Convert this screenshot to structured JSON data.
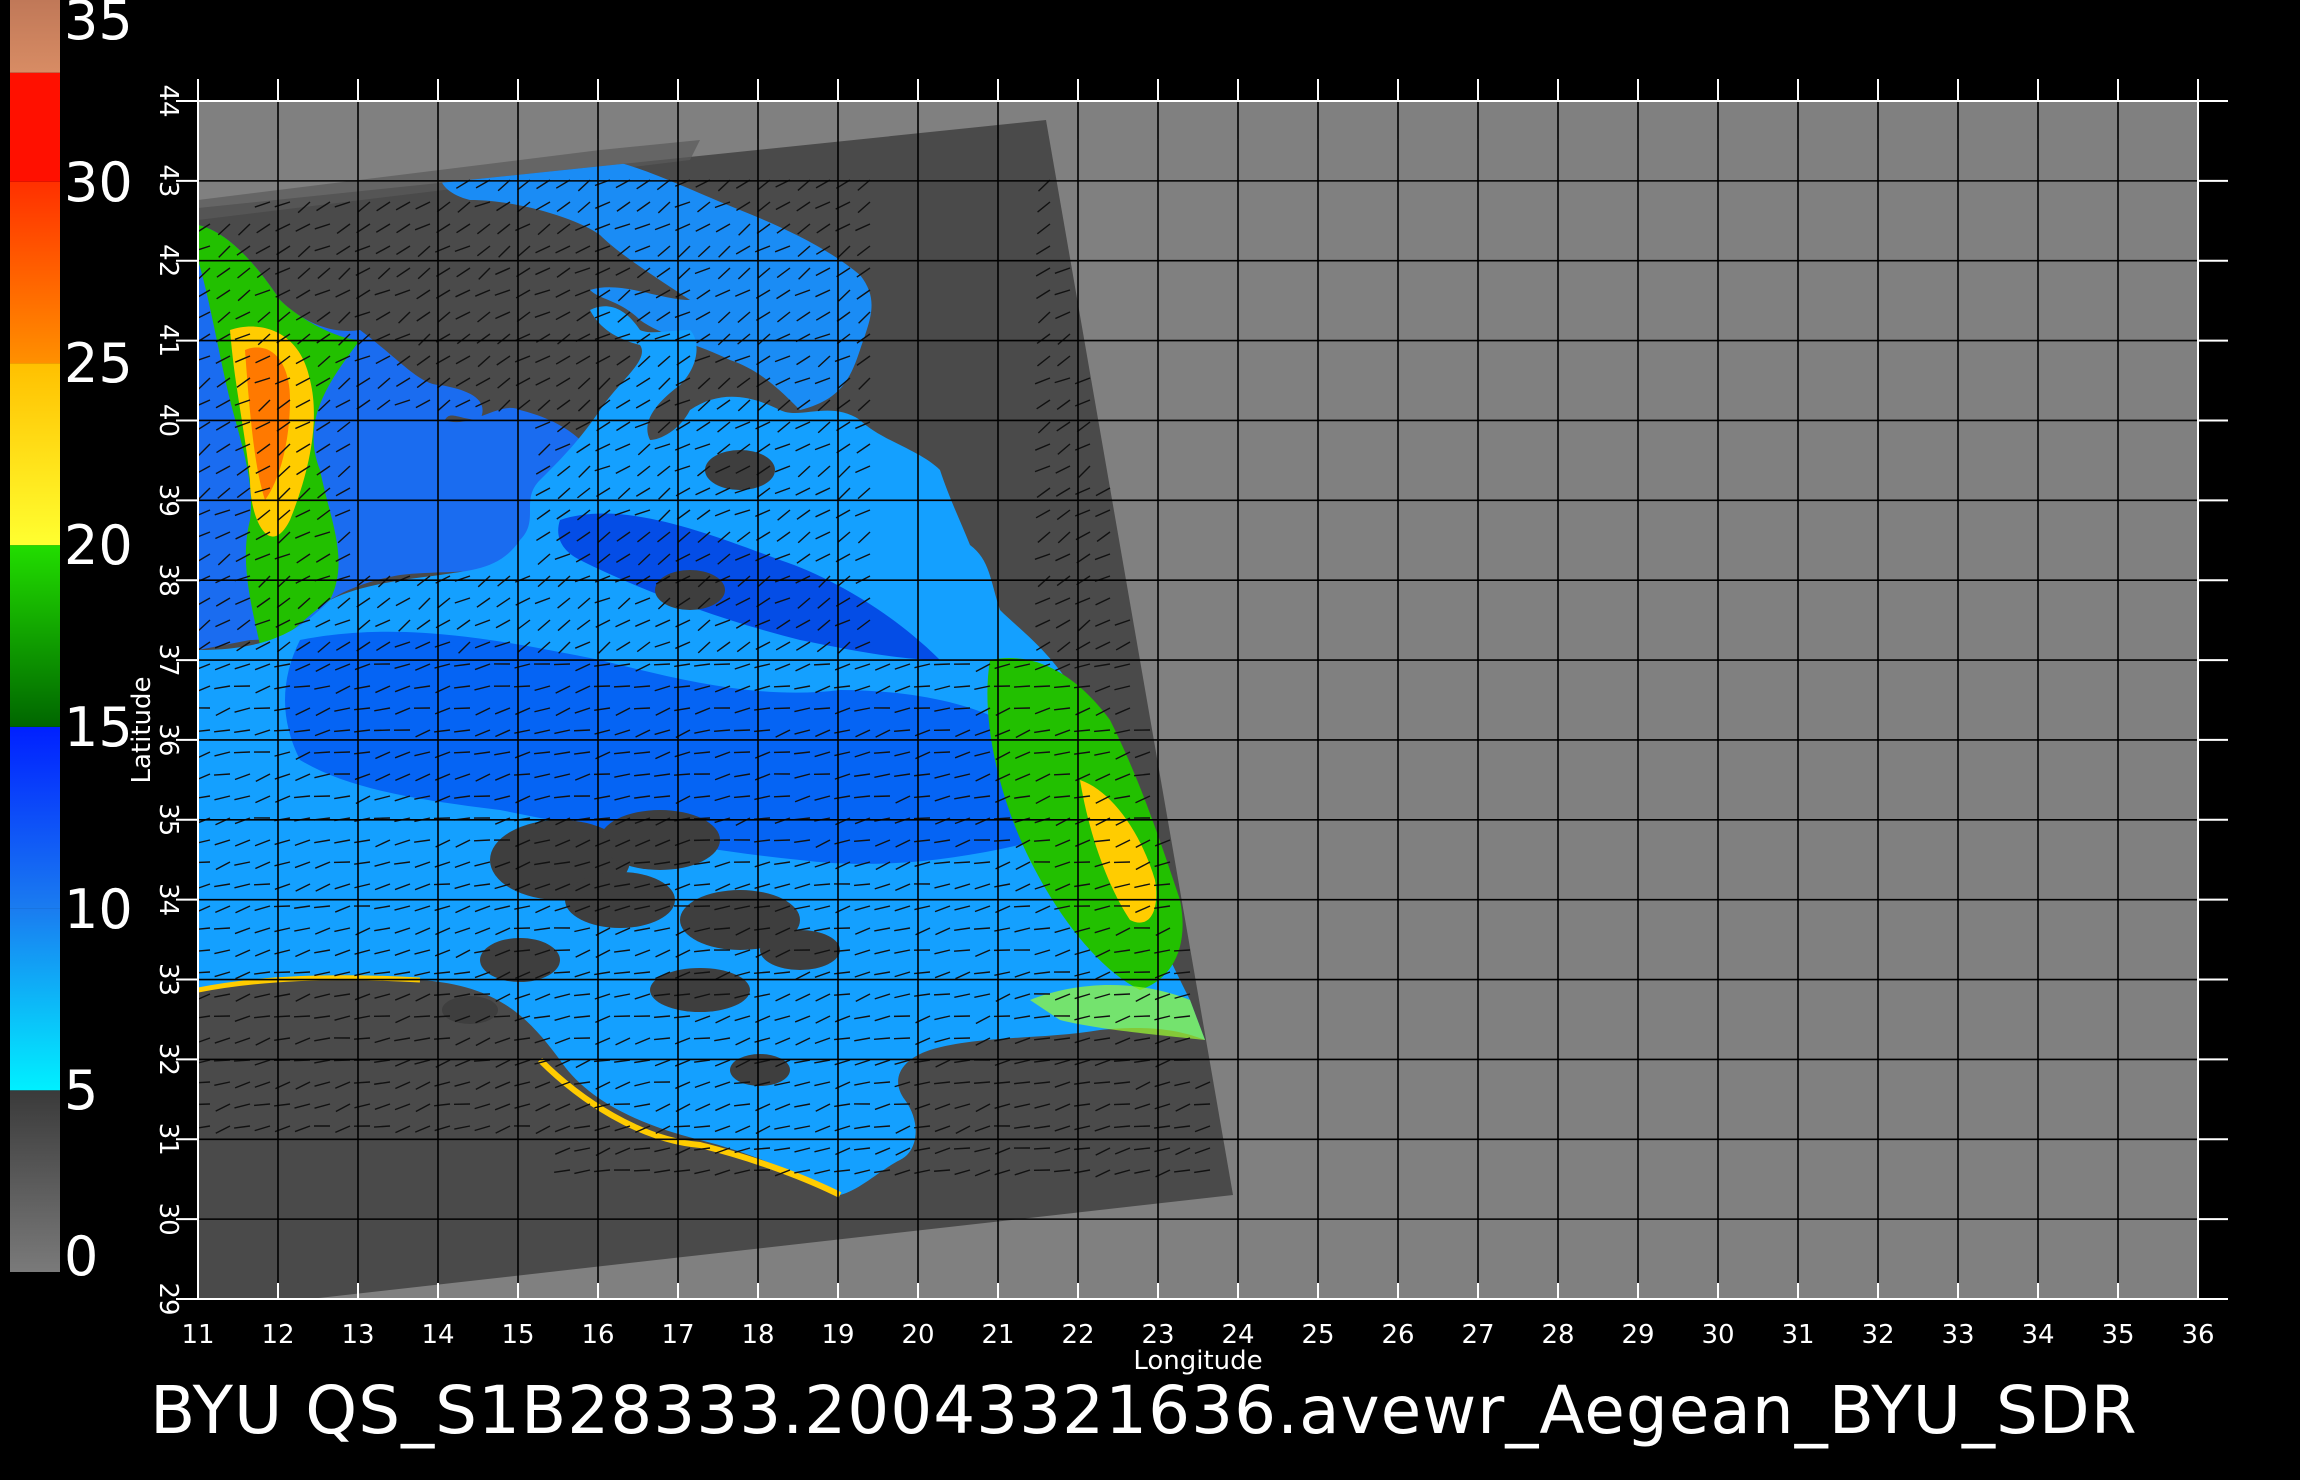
{
  "colorbar": {
    "labels": [
      "0",
      "5",
      "10",
      "15",
      "20",
      "25",
      "30",
      "35"
    ],
    "segments": [
      {
        "from": 0,
        "to": 5,
        "colors": [
          "#7a7a7a",
          "#3a3a3a"
        ]
      },
      {
        "from": 5,
        "to": 10,
        "colors": [
          "#00f0ff",
          "#1a7cf0"
        ]
      },
      {
        "from": 10,
        "to": 15,
        "colors": [
          "#1a7cf0",
          "#0020ff"
        ]
      },
      {
        "from": 15,
        "to": 20,
        "colors": [
          "#006600",
          "#22dd00"
        ]
      },
      {
        "from": 20,
        "to": 25,
        "colors": [
          "#ffff30",
          "#ffc000"
        ]
      },
      {
        "from": 25,
        "to": 30,
        "colors": [
          "#ff9000",
          "#ff3000"
        ]
      },
      {
        "from": 30,
        "to": 33,
        "colors": [
          "#ff1000",
          "#ff1000"
        ]
      },
      {
        "from": 33,
        "to": 35,
        "colors": [
          "#d88c64",
          "#c07858"
        ]
      }
    ]
  },
  "map": {
    "x_axis_label": "Longitude",
    "y_axis_label": "Latitude",
    "lon_range": [
      11,
      36
    ],
    "lat_range": [
      29,
      44
    ],
    "lon_ticks": [
      "11",
      "12",
      "13",
      "14",
      "15",
      "16",
      "17",
      "18",
      "19",
      "20",
      "21",
      "22",
      "23",
      "24",
      "25",
      "26",
      "27",
      "28",
      "29",
      "30",
      "31",
      "32",
      "33",
      "34",
      "35",
      "36"
    ],
    "lat_ticks": [
      "29",
      "30",
      "31",
      "32",
      "33",
      "34",
      "35",
      "36",
      "37",
      "38",
      "39",
      "40",
      "41",
      "42",
      "43",
      "44"
    ],
    "colors": {
      "background": "#000000",
      "no_data": "#808080",
      "land_in_swath": "#4a4a4a",
      "grid": "#000000",
      "low_wind": "#00a8ff",
      "medium_wind": "#0038f0",
      "high_wind": "#22c000",
      "strong_wind": "#ffd400"
    }
  },
  "title": "BYU  QS_S1B28333.20043321636.avewr_Aegean_BYU_SDR"
}
